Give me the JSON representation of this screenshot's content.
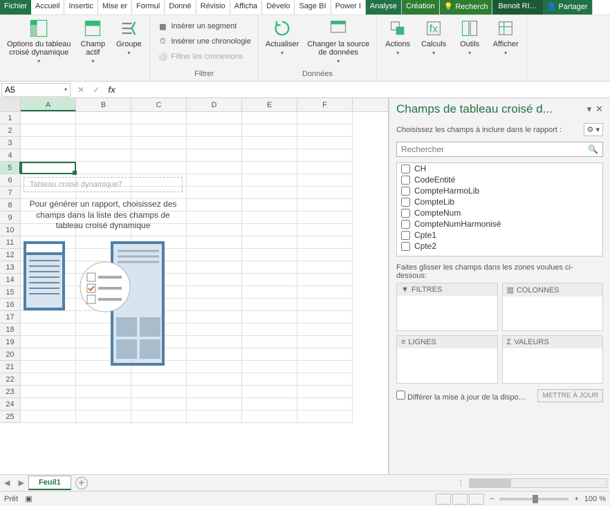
{
  "menu": {
    "file": "Fichier",
    "tabs": [
      "Accueil",
      "Insertic",
      "Mise er",
      "Formul",
      "Donné",
      "Révisio",
      "Afficha",
      "Dévelo",
      "Sage BI",
      "Power I"
    ],
    "active": "Analyse",
    "contextual": "Création",
    "search": "Recherch",
    "user": "Benoit RI…",
    "share": "Partager"
  },
  "ribbon": {
    "g1": {
      "btn1": "Options du tableau\ncroisé dynamique",
      "btn2": "Champ\nactif",
      "btn3": "Groupe"
    },
    "g2": {
      "label": "Filtrer",
      "i1": "Insérer un segment",
      "i2": "Insérer une chronologie",
      "i3": "Filtrer les connexions"
    },
    "g3": {
      "label": "Données",
      "b1": "Actualiser",
      "b2": "Changer la source\nde données"
    },
    "g4": {
      "a": "Actions",
      "c": "Calculs",
      "o": "Outils",
      "af": "Afficher"
    }
  },
  "namebox": "A5",
  "columns": [
    "A",
    "B",
    "C",
    "D",
    "E",
    "F"
  ],
  "rowcount": 25,
  "activeCol": 0,
  "activeRow": 5,
  "pivot": {
    "name": "Tableau croisé dynamique7",
    "hint": "Pour générer un rapport, choisissez des champs dans la liste des champs de tableau croisé dynamique"
  },
  "pane": {
    "title": "Champs de tableau croisé d...",
    "sub": "Choisissez les champs à inclure dans le rapport :",
    "searchPlaceholder": "Rechercher",
    "fields": [
      "CH",
      "CodeEntité",
      "CompteHarmoLib",
      "CompteLib",
      "CompteNum",
      "CompteNumHarmonisé",
      "Cpte1",
      "Cpte2"
    ],
    "dragtxt": "Faites glisser les champs dans les zones voulues ci-dessous:",
    "zones": {
      "filters": "FILTRES",
      "cols": "COLONNES",
      "rows": "LIGNES",
      "vals": "VALEURS"
    },
    "defer": "Différer la mise à jour de la dispo…",
    "update": "METTRE À JOUR"
  },
  "sheet": {
    "tab": "Feuil1"
  },
  "status": {
    "ready": "Prêt",
    "zoom": "100 %"
  }
}
